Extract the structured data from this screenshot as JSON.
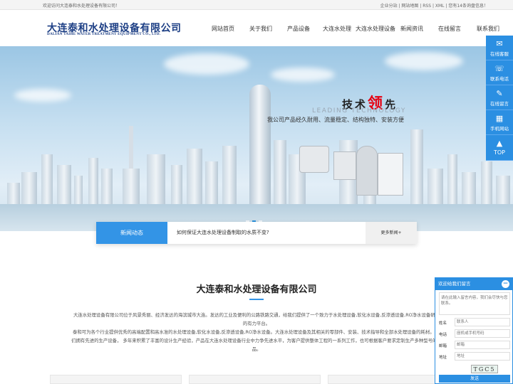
{
  "topbar": {
    "welcome": "欢迎访问大连泰和水处理设备有限公司！",
    "links": "企业分站 | 网站地图 | RSS | XML | 您有14条询盘信息！"
  },
  "logo": {
    "cn": "大连泰和水处理设备有限公司",
    "en": "DALIAN TAIHE WATER TREATMENT EQUIPMENT CO., LTD."
  },
  "nav": [
    "网站首页",
    "关于我们",
    "产品设备",
    "大连水处理",
    "大连水处理设备",
    "新闻资讯",
    "在线留言",
    "联系我们"
  ],
  "banner": {
    "slogan_pre": "技术",
    "slogan_red": "领",
    "slogan_post": "先",
    "slogan_en": "LEADING TECHNOLOGY",
    "slogan_sub": "我公司产品经久耐用、流量稳定、结构独特、安装方便",
    "slide_count": 3,
    "active_slide": 2
  },
  "news": {
    "label": "新闻动态",
    "headline": "如何保证大连水处理设备制取的水质不变?",
    "more": "更多新闻+"
  },
  "intro": {
    "title": "大连泰和水处理设备有限公司",
    "p1": "大连水处理设备有限公司位于风景秀丽、经济发达的海滨城市大连。发达的工业及便利的公路铁路交通，给我们提供了一个致力于水处理设备,软化水设备,反渗透设备,RO净水设备研发的有力平台。",
    "p2": "泰和可为各个行业提供优秀的高端配置和高水准的水处理设备,软化水设备,反渗透设备,RO净水设备。大连水处理设备及其相关的零部件、安装、技术指导和全部水处理设备的耗材。 我们拥有先进的生产设备， 多年来积累了丰富的设计生产经验，产品在大连水处理设备行业中力争先进水平，为客户提供整体工程的一系列工作，也可根据客户要求定制生产多种型号的产品。"
  },
  "side": {
    "service": "在线客服",
    "phone": "联系电话",
    "message": "在线留言",
    "mobile": "手机网站",
    "top": "TOP"
  },
  "msg": {
    "title": "欢迎给我们留言",
    "close": "−",
    "content_placeholder": "请在此输入留言内容，我们会尽快与您联系。",
    "name_label": "姓名",
    "name_placeholder": "联系人",
    "phone_label": "电话",
    "phone_placeholder": "座机或手机号码",
    "email_label": "邮箱",
    "email_placeholder": "邮箱",
    "addr_label": "地址",
    "addr_placeholder": "地址",
    "captcha": "TGC5",
    "send": "发送"
  },
  "colors": {
    "primary": "#2b8fe2",
    "logo": "#1d3f85",
    "accent": "#e60012"
  }
}
